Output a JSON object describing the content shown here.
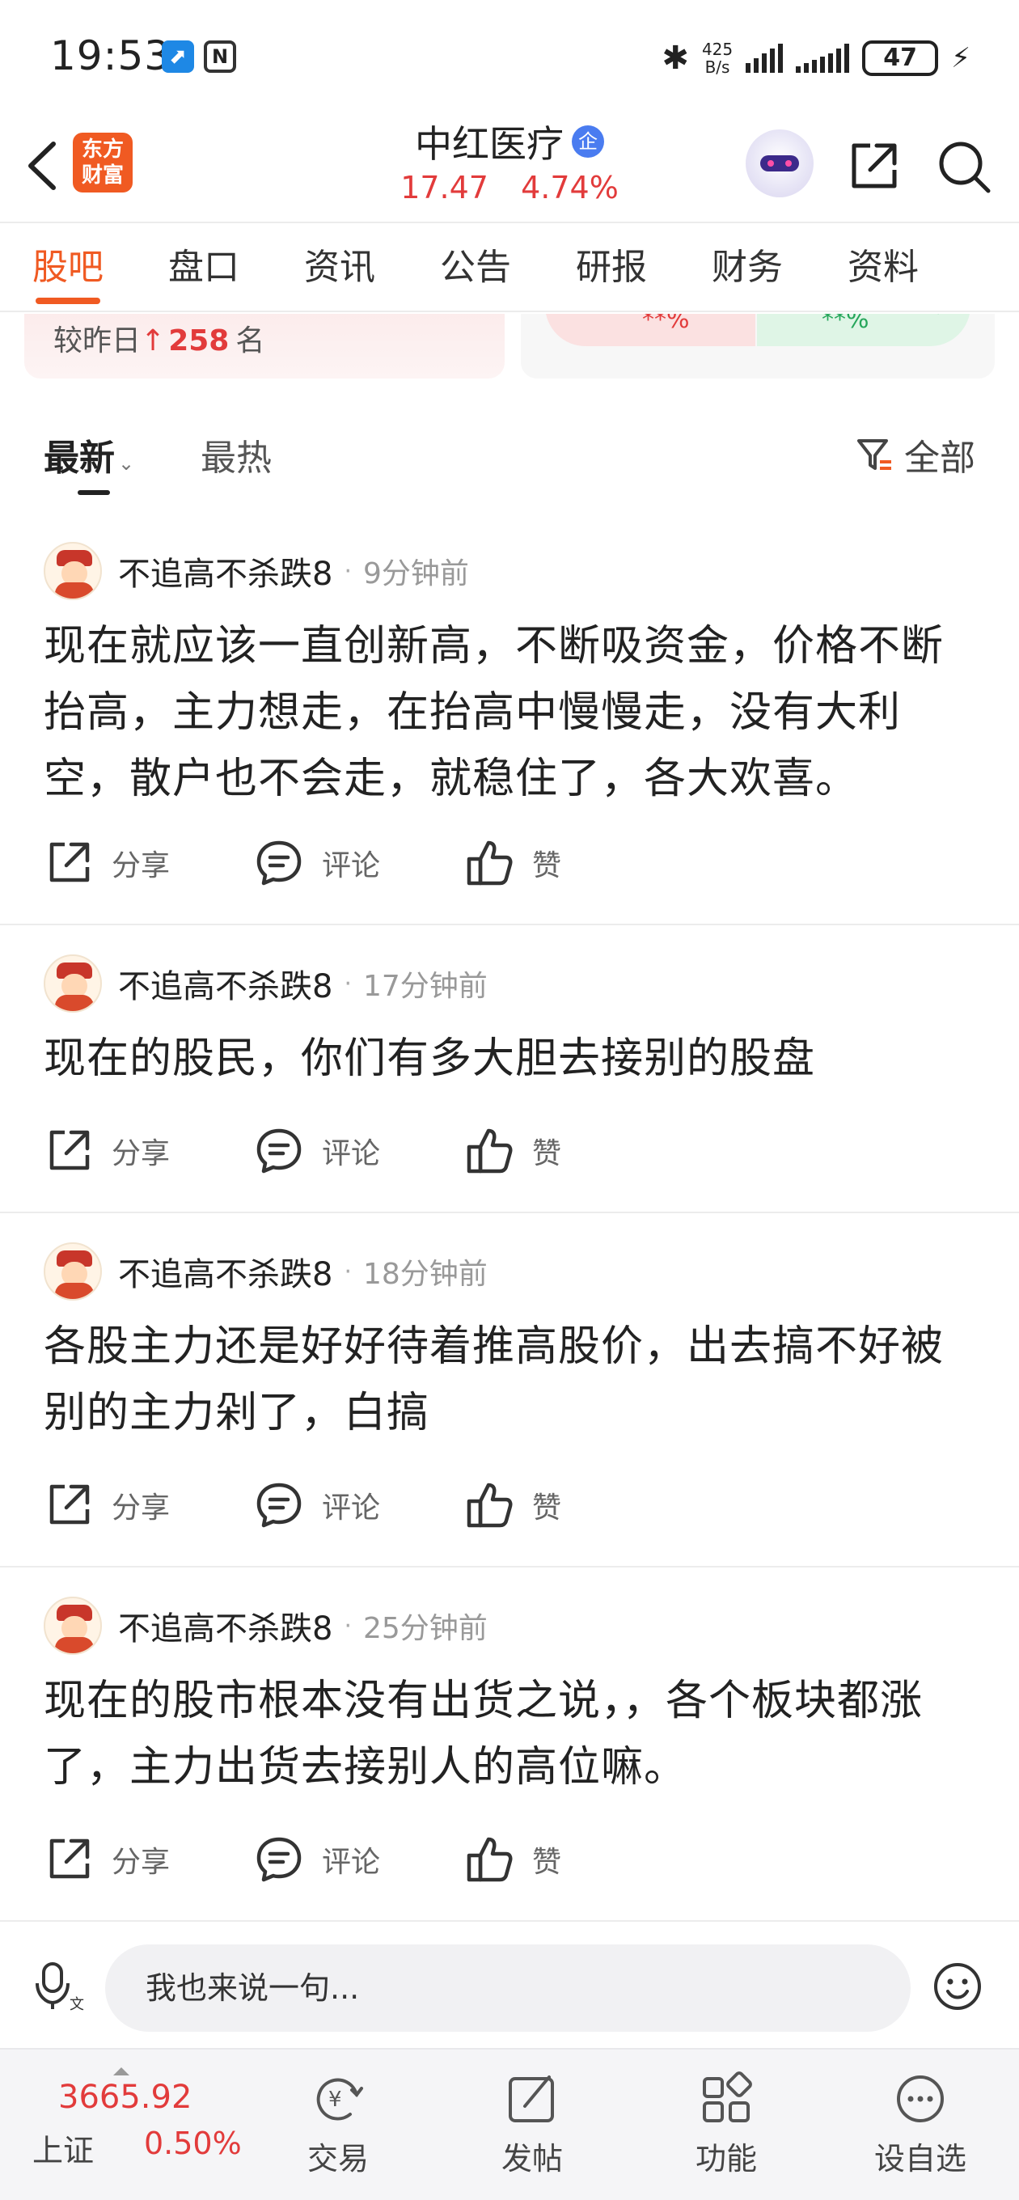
{
  "status_bar": {
    "time": "19:53",
    "speed_value": "425",
    "speed_unit": "B/s",
    "battery": "47"
  },
  "header": {
    "logo_line1": "东方",
    "logo_line2": "财富",
    "stock_name": "中红医疗",
    "badge": "企",
    "price": "17.47",
    "change_pct": "4.74%"
  },
  "tabs": [
    {
      "label": "股吧",
      "active": true
    },
    {
      "label": "盘口"
    },
    {
      "label": "资讯"
    },
    {
      "label": "公告"
    },
    {
      "label": "研报"
    },
    {
      "label": "财务"
    },
    {
      "label": "资料"
    }
  ],
  "rank_card": {
    "prefix": "较昨日",
    "arrow": "↑",
    "value": "258",
    "suffix": "名",
    "bear_pct": "**%",
    "bull_pct": "**%"
  },
  "sort_bar": {
    "latest": "最新",
    "hot": "最热",
    "filter": "全部"
  },
  "post_actions": {
    "share": "分享",
    "comment": "评论",
    "like": "赞"
  },
  "posts": [
    {
      "author": "不追高不杀跌8",
      "time": "9分钟前",
      "content": "现在就应该一直创新高，不断吸资金，价格不断抬高，主力想走，在抬高中慢慢走，没有大利空，散户也不会走，就稳住了，各大欢喜。"
    },
    {
      "author": "不追高不杀跌8",
      "time": "17分钟前",
      "content": "现在的股民，你们有多大胆去接别的股盘"
    },
    {
      "author": "不追高不杀跌8",
      "time": "18分钟前",
      "content": "各股主力还是好好待着推高股价，出去搞不好被别的主力剁了，白搞"
    },
    {
      "author": "不追高不杀跌8",
      "time": "25分钟前",
      "content": "现在的股市根本没有出货之说，，各个板块都涨了，主力出货去接别人的高位嘛。"
    }
  ],
  "comment_bar": {
    "placeholder": "我也来说一句..."
  },
  "bottom_nav": {
    "index_value": "3665.92",
    "index_name": "上证",
    "index_change": "0.50%",
    "items": [
      {
        "label": "交易",
        "icon": "yen-exchange-icon"
      },
      {
        "label": "发帖",
        "icon": "edit-post-icon"
      },
      {
        "label": "功能",
        "icon": "grid-icon"
      },
      {
        "label": "设自选",
        "icon": "more-dots-icon"
      }
    ]
  },
  "colors": {
    "brand": "#f05a22",
    "up": "#e23b3b",
    "down": "#26a65b"
  }
}
